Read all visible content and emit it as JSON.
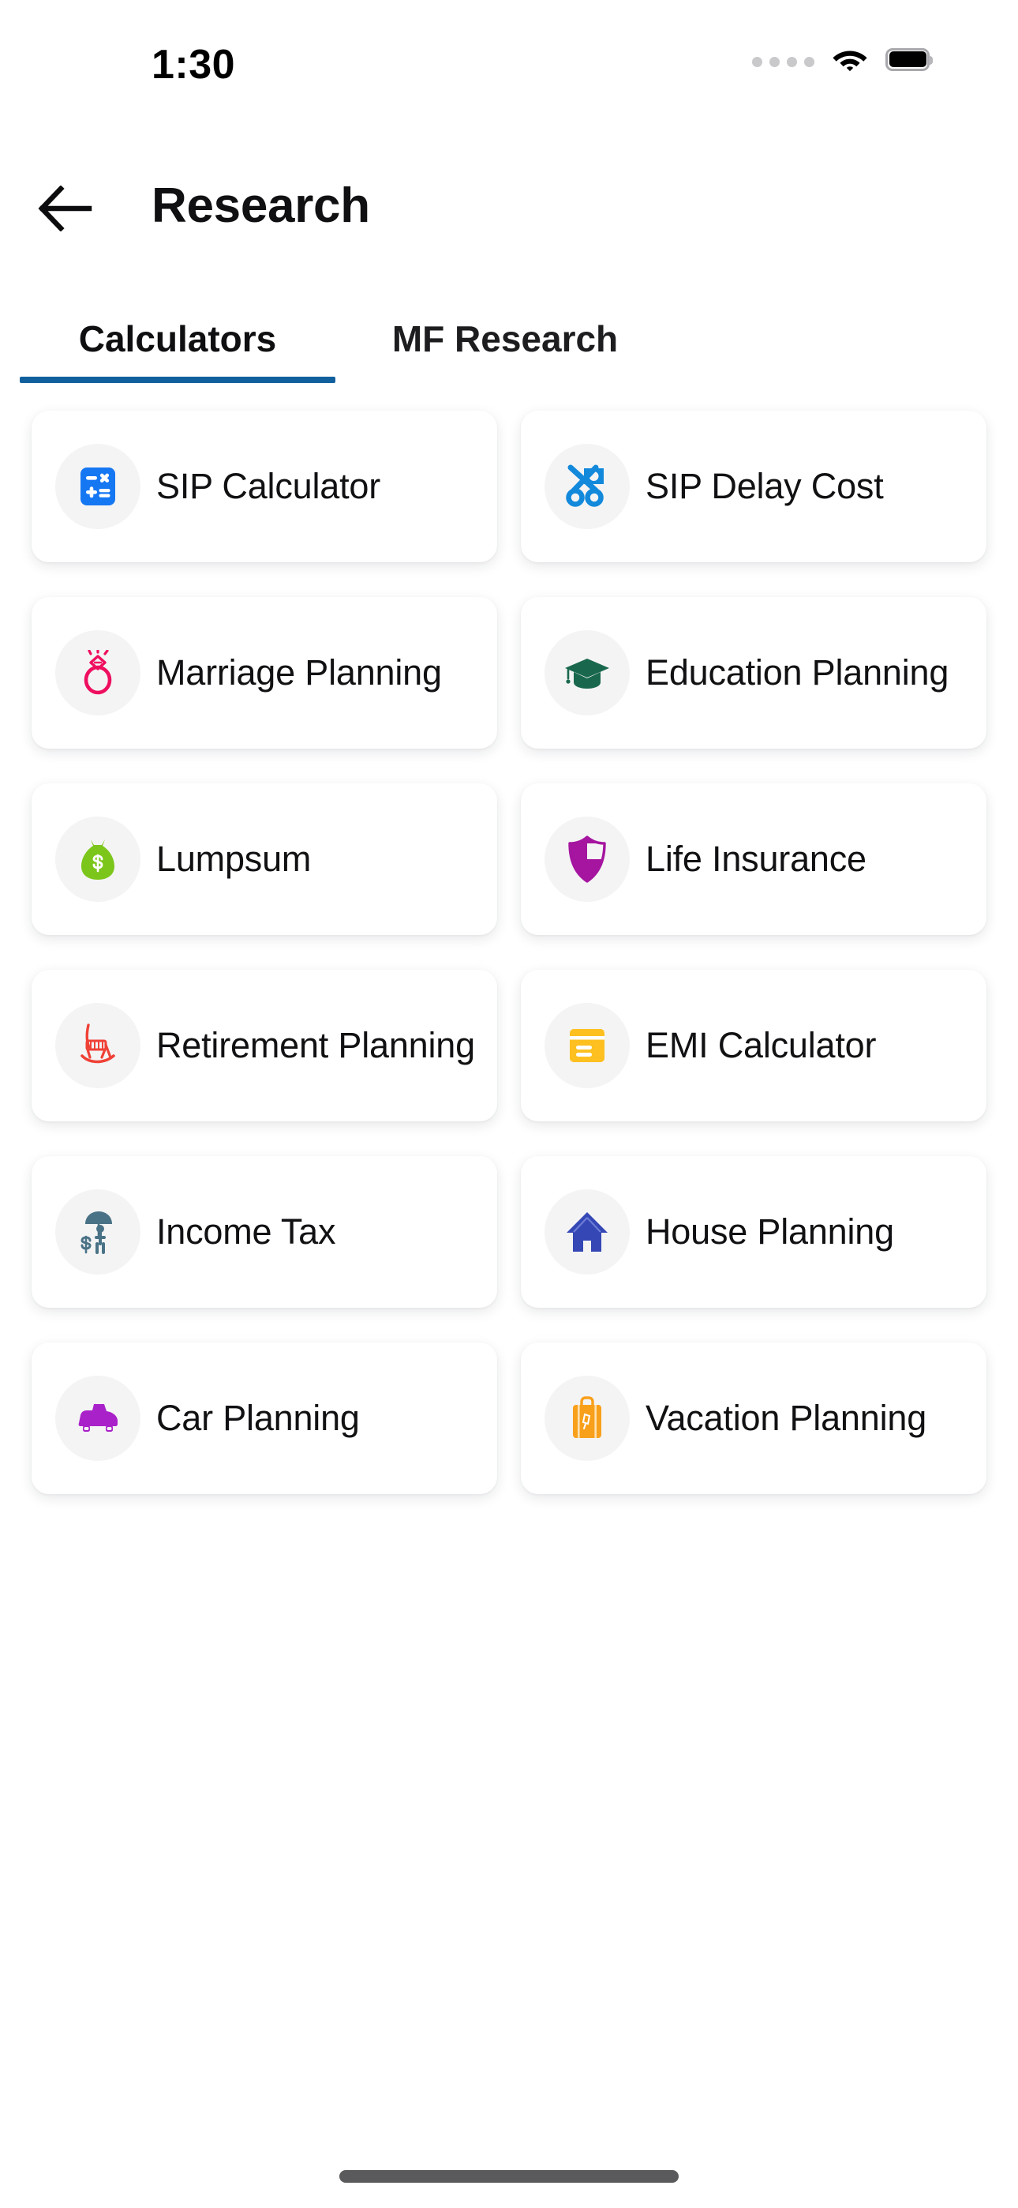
{
  "status_bar": {
    "time": "1:30",
    "signal_icon": "signal-dots-icon",
    "wifi_icon": "wifi-icon",
    "battery_icon": "battery-full-icon"
  },
  "header": {
    "back_icon": "arrow-left-icon",
    "title": "Research"
  },
  "tabs": {
    "active_index": 0,
    "items": [
      {
        "label": "Calculators"
      },
      {
        "label": "MF Research"
      }
    ],
    "underline_color": "#11609e"
  },
  "calculators": [
    {
      "label": "SIP Calculator",
      "icon": "calculator-icon",
      "color": "#1677f2"
    },
    {
      "label": "SIP Delay Cost",
      "icon": "scissors-money-icon",
      "color": "#1389db"
    },
    {
      "label": "Marriage Planning",
      "icon": "diamond-ring-icon",
      "color": "#ef0f5f"
    },
    {
      "label": "Education Planning",
      "icon": "graduation-cap-icon",
      "color": "#19684d"
    },
    {
      "label": "Lumpsum",
      "icon": "money-bag-icon",
      "color": "#7cc61c"
    },
    {
      "label": "Life Insurance",
      "icon": "shield-icon",
      "color": "#a5159f"
    },
    {
      "label": "Retirement Planning",
      "icon": "rocking-chair-icon",
      "color": "#ef4136"
    },
    {
      "label": "EMI Calculator",
      "icon": "credit-card-icon",
      "color": "#fdc020"
    },
    {
      "label": "Income Tax",
      "icon": "umbrella-person-icon",
      "color": "#4a7286"
    },
    {
      "label": "House Planning",
      "icon": "house-icon",
      "color": "#3447b5"
    },
    {
      "label": "Car Planning",
      "icon": "car-icon",
      "color": "#a921c9"
    },
    {
      "label": "Vacation Planning",
      "icon": "suitcase-icon",
      "color": "#f9a01b"
    }
  ],
  "home_indicator": "home-indicator"
}
